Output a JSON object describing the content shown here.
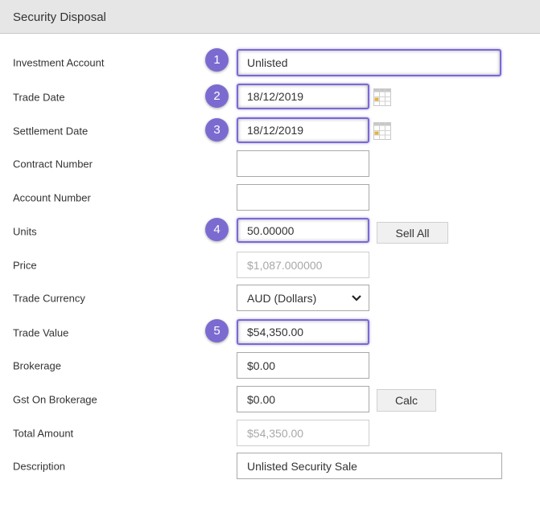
{
  "header": {
    "title": "Security Disposal"
  },
  "fields": {
    "investment_account": {
      "label": "Investment Account",
      "value": "Unlisted",
      "badge": "1"
    },
    "trade_date": {
      "label": "Trade Date",
      "value": "18/12/2019",
      "badge": "2",
      "icon": "calendar-icon"
    },
    "settlement_date": {
      "label": "Settlement Date",
      "value": "18/12/2019",
      "badge": "3",
      "icon": "calendar-icon"
    },
    "contract_number": {
      "label": "Contract Number",
      "value": ""
    },
    "account_number": {
      "label": "Account Number",
      "value": ""
    },
    "units": {
      "label": "Units",
      "value": "50.00000",
      "badge": "4",
      "button": "Sell All"
    },
    "price": {
      "label": "Price",
      "value": "$1,087.000000"
    },
    "trade_currency": {
      "label": "Trade Currency",
      "value": "AUD (Dollars)",
      "icon": "chevron-down-icon"
    },
    "trade_value": {
      "label": "Trade Value",
      "value": "$54,350.00",
      "badge": "5"
    },
    "brokerage": {
      "label": "Brokerage",
      "value": "$0.00"
    },
    "gst_on_brokerage": {
      "label": "Gst On Brokerage",
      "value": "$0.00",
      "button": "Calc"
    },
    "total_amount": {
      "label": "Total Amount",
      "value": "$54,350.00"
    },
    "description": {
      "label": "Description",
      "value": "Unlisted Security Sale"
    }
  },
  "colors": {
    "accent": "#7b6bd0",
    "header_bg": "#e6e6e6"
  }
}
